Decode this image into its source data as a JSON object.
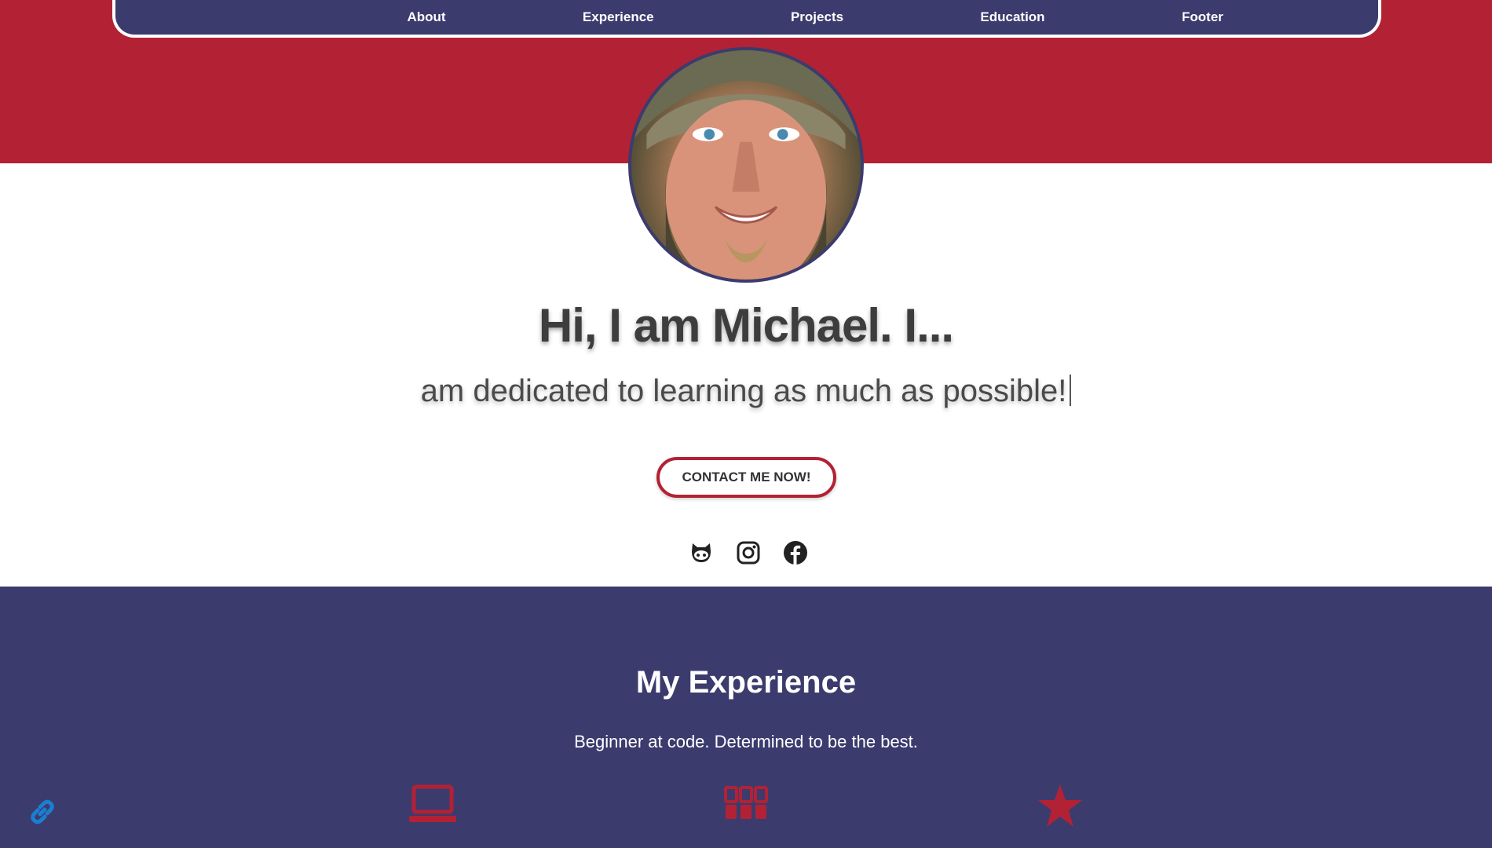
{
  "nav": {
    "items": [
      {
        "label": "About"
      },
      {
        "label": "Experience"
      },
      {
        "label": "Projects"
      },
      {
        "label": "Education"
      },
      {
        "label": "Footer"
      }
    ]
  },
  "hero": {
    "title": "Hi, I am Michael. I...",
    "subtitle": "am dedicated to learning as much as possible!",
    "contact_button": "CONTACT ME NOW!",
    "social_icons": [
      "github-icon",
      "instagram-icon",
      "facebook-icon"
    ]
  },
  "experience": {
    "title": "My Experience",
    "description": "Beginner at code. Determined to be the best.",
    "icons": [
      "laptop-icon",
      "grid-icon",
      "star-icon"
    ]
  },
  "colors": {
    "red": "#b22234",
    "navy": "#3c3b6e",
    "white": "#ffffff",
    "link_blue": "#1a7fd0"
  }
}
